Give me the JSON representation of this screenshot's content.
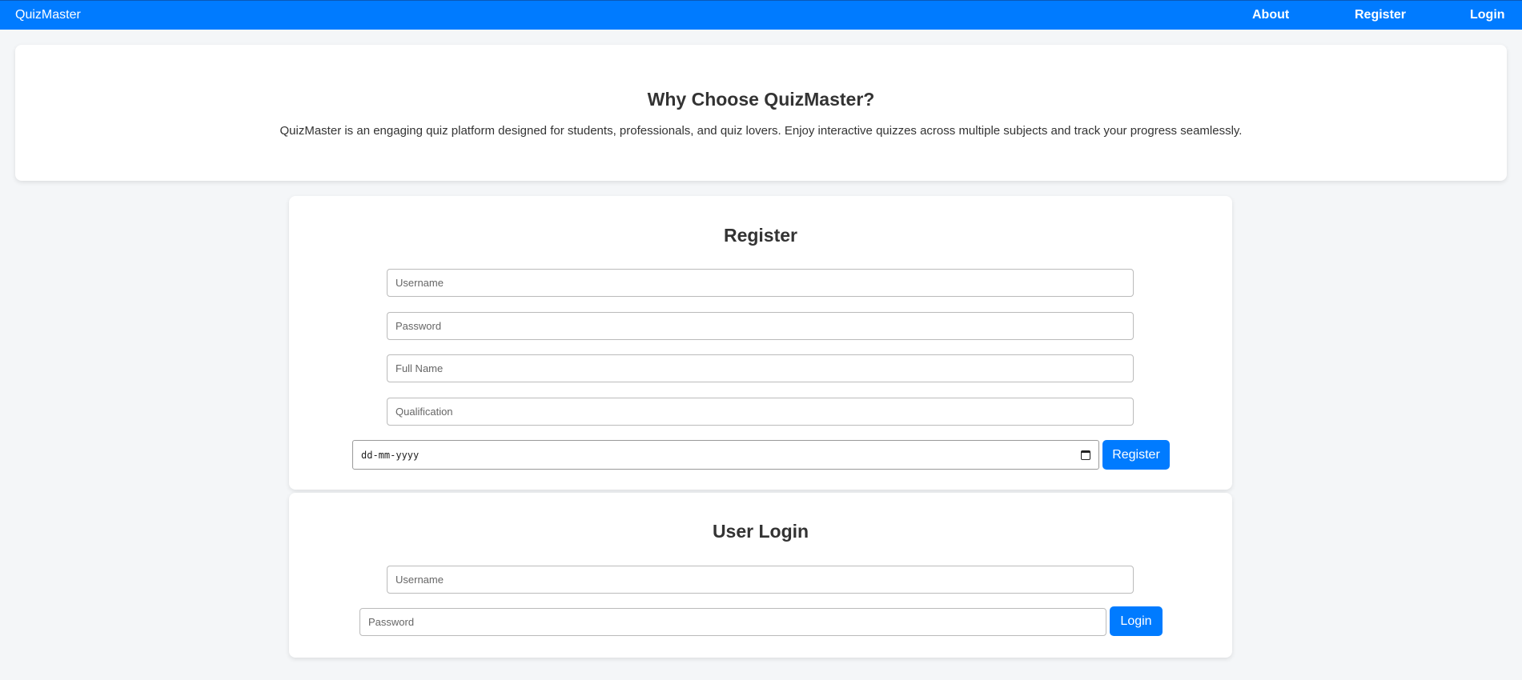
{
  "nav": {
    "brand": "QuizMaster",
    "links": [
      "About",
      "Register",
      "Login"
    ]
  },
  "hero": {
    "title": "Why Choose QuizMaster?",
    "description": "QuizMaster is an engaging quiz platform designed for students, professionals, and quiz lovers. Enjoy interactive quizzes across multiple subjects and track your progress seamlessly."
  },
  "register": {
    "title": "Register",
    "username_placeholder": "Username",
    "password_placeholder": "Password",
    "fullname_placeholder": "Full Name",
    "qualification_placeholder": "Qualification",
    "dob_placeholder": "dd-mm-yyyy",
    "button_label": "Register"
  },
  "login": {
    "title": "User Login",
    "username_placeholder": "Username",
    "password_placeholder": "Password",
    "button_label": "Login"
  },
  "colors": {
    "primary": "#007bff",
    "background": "#f4f6f8",
    "card": "#ffffff"
  },
  "icons": {
    "date_picker": "calendar-icon"
  }
}
